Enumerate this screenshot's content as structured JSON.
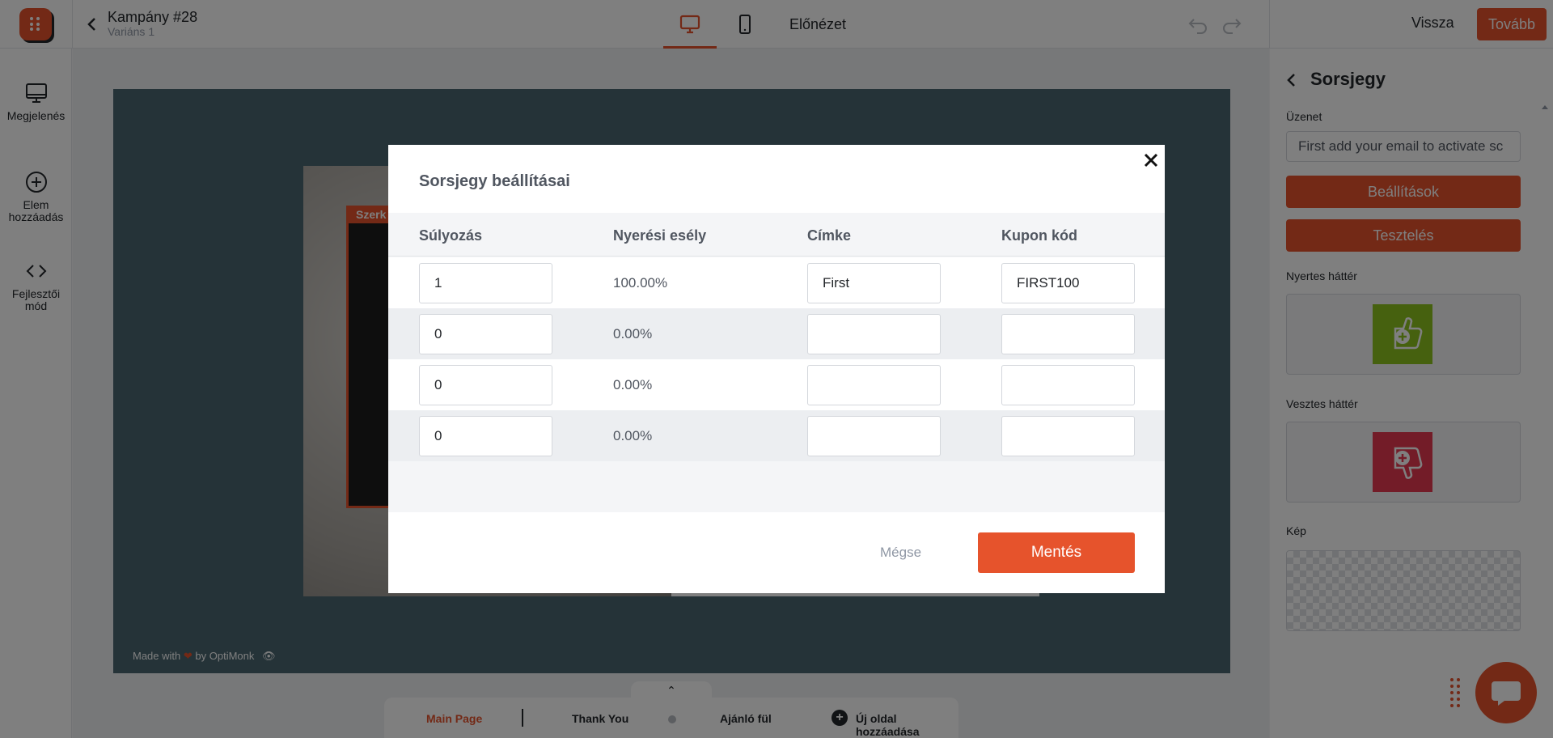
{
  "topbar": {
    "campaign_title": "Kampány #28",
    "campaign_subtitle": "Variáns 1",
    "preview_label": "Előnézet",
    "back_label": "Vissza",
    "next_label": "Tovább"
  },
  "leftbar": {
    "items": [
      {
        "label": "Megjelenés",
        "icon": "monitor-icon"
      },
      {
        "label": "Elem hozzáadás",
        "icon": "plus-circle-icon"
      },
      {
        "label": "Fejlesztői mód",
        "icon": "code-icon"
      }
    ]
  },
  "canvas": {
    "edit_tag": "Szerk",
    "made_with_prefix": "Made with",
    "made_with_suffix": "by OptiMonk"
  },
  "page_tabs": {
    "toggle": "⌃",
    "main": "Main Page",
    "thank_you": "Thank You",
    "offer": "Ajánló fül",
    "add_page": "Új oldal hozzáadása"
  },
  "right_panel": {
    "title": "Sorsjegy",
    "message_label": "Üzenet",
    "message_value": "First add your email to activate sc",
    "settings_button": "Beállítások",
    "test_button": "Tesztelés",
    "winner_bg_label": "Nyertes háttér",
    "loser_bg_label": "Vesztes háttér",
    "image_label": "Kép"
  },
  "modal": {
    "title": "Sorsjegy beállításai",
    "columns": [
      "Súlyozás",
      "Nyerési esély",
      "Címke",
      "Kupon kód"
    ],
    "rows": [
      {
        "weight": "1",
        "chance": "100.00%",
        "label": "First",
        "coupon": "FIRST100"
      },
      {
        "weight": "0",
        "chance": "0.00%",
        "label": "",
        "coupon": ""
      },
      {
        "weight": "0",
        "chance": "0.00%",
        "label": "",
        "coupon": ""
      },
      {
        "weight": "0",
        "chance": "0.00%",
        "label": "",
        "coupon": ""
      }
    ],
    "cancel_label": "Mégse",
    "save_label": "Mentés"
  },
  "colors": {
    "accent": "#e6532c",
    "winner_green": "#8dc21f",
    "loser_red": "#e63950",
    "stage": "#4a6670"
  }
}
